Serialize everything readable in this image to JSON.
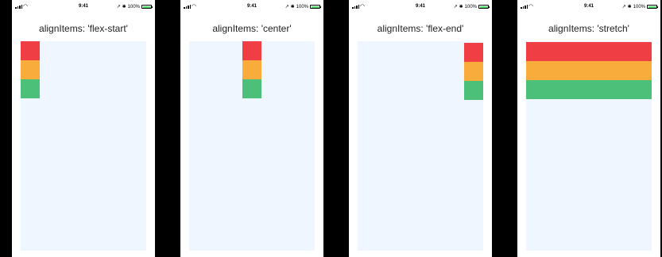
{
  "status_bar": {
    "time": "9:41",
    "battery": "100%"
  },
  "colors": {
    "red": "#ef3f45",
    "orange": "#f8ac3b",
    "green": "#4cbf78",
    "container_bg": "#eff6ff"
  },
  "phones": [
    {
      "title": "alignItems: 'flex-start'",
      "align": "flex-start"
    },
    {
      "title": "alignItems: 'center'",
      "align": "center"
    },
    {
      "title": "alignItems: 'flex-end'",
      "align": "flex-end"
    },
    {
      "title": "alignItems: 'stretch'",
      "align": "stretch"
    }
  ]
}
